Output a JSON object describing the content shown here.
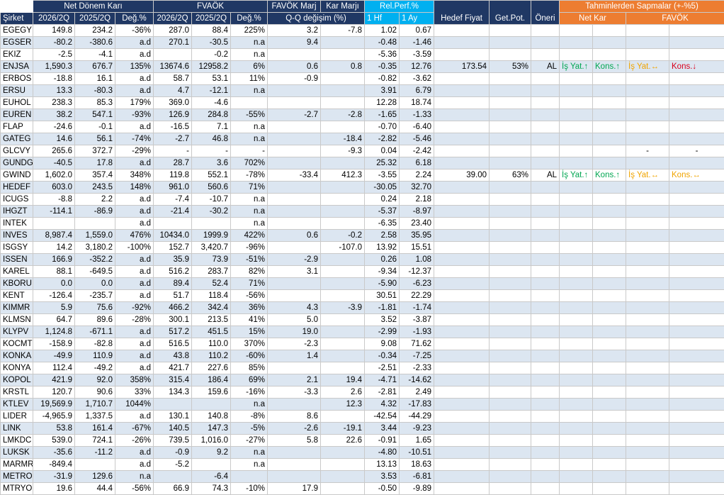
{
  "columns": {
    "company": "Şirket",
    "net_kar_group": "Net Dönem Karı",
    "favok_group": "FVAÖK",
    "favok_marj": "FAVÖK Marj",
    "kar_marj": "Kar Marjı",
    "qq": "Q-Q değişim (%)",
    "relperf": "Rel.Perf.%",
    "hf1": "1 Hf",
    "ay1": "1 Ay",
    "hedef": "Hedef Fiyat",
    "getpot": "Get.Pot.",
    "oneri": "Öneri",
    "sapma_group": "Tahminlerden Sapmalar (+-%5)",
    "sapma_net": "Net Kar",
    "sapma_favok": "FAVÖK",
    "p2026": "2026/2Q",
    "p2025": "2025/2Q",
    "chg": "Değ.%"
  },
  "rows": [
    {
      "n": "EGEGY",
      "nk26": "149.8",
      "nk25": "234.2",
      "nkc": "-36%",
      "f26": "287.0",
      "f25": "88.4",
      "fc": "225%",
      "fm": "3.2",
      "km": "-7.8",
      "hf": "1.02",
      "ay": "0.67",
      "hd": "",
      "gp": "",
      "on": "",
      "s1": "",
      "s2": "",
      "s3": "",
      "s4": ""
    },
    {
      "n": "EGSER",
      "nk26": "-80.2",
      "nk25": "-380.6",
      "nkc": "a.d",
      "f26": "270.1",
      "f25": "-30.5",
      "fc": "n.a",
      "fm": "9.4",
      "km": "",
      "hf": "-0.48",
      "ay": "-1.46",
      "hd": "",
      "gp": "",
      "on": "",
      "s1": "",
      "s2": "",
      "s3": "",
      "s4": ""
    },
    {
      "n": "EKIZ",
      "nk26": "-2.5",
      "nk25": "-4.1",
      "nkc": "a.d",
      "f26": "",
      "f25": "-0.2",
      "fc": "n.a",
      "fm": "",
      "km": "",
      "hf": "-5.36",
      "ay": "-3.59",
      "hd": "",
      "gp": "",
      "on": "",
      "s1": "",
      "s2": "",
      "s3": "",
      "s4": ""
    },
    {
      "n": "ENJSA",
      "nk26": "1,590.3",
      "nk25": "676.7",
      "nkc": "135%",
      "f26": "13674.6",
      "f25": "12958.2",
      "fc": "6%",
      "fm": "0.6",
      "km": "0.8",
      "hf": "-0.35",
      "ay": "12.76",
      "hd": "173.54",
      "gp": "53%",
      "on": "AL",
      "s1": "İş Yat.↑",
      "s2": "Kons.↑",
      "s3": "İş Yat.↔",
      "s4": "Kons.↓",
      "c1": "green",
      "c2": "green",
      "c3": "amber",
      "c4": "red"
    },
    {
      "n": "ERBOS",
      "nk26": "-18.8",
      "nk25": "16.1",
      "nkc": "a.d",
      "f26": "58.7",
      "f25": "53.1",
      "fc": "11%",
      "fm": "-0.9",
      "km": "",
      "hf": "-0.82",
      "ay": "-3.62",
      "hd": "",
      "gp": "",
      "on": "",
      "s1": "",
      "s2": "",
      "s3": "",
      "s4": ""
    },
    {
      "n": "ERSU",
      "nk26": "13.3",
      "nk25": "-80.3",
      "nkc": "a.d",
      "f26": "4.7",
      "f25": "-12.1",
      "fc": "n.a",
      "fm": "",
      "km": "",
      "hf": "3.91",
      "ay": "6.79",
      "hd": "",
      "gp": "",
      "on": "",
      "s1": "",
      "s2": "",
      "s3": "",
      "s4": ""
    },
    {
      "n": "EUHOL",
      "nk26": "238.3",
      "nk25": "85.3",
      "nkc": "179%",
      "f26": "369.0",
      "f25": "-4.6",
      "fc": "",
      "fm": "",
      "km": "",
      "hf": "12.28",
      "ay": "18.74",
      "hd": "",
      "gp": "",
      "on": "",
      "s1": "",
      "s2": "",
      "s3": "",
      "s4": ""
    },
    {
      "n": "EUREN",
      "nk26": "38.2",
      "nk25": "547.1",
      "nkc": "-93%",
      "f26": "126.9",
      "f25": "284.8",
      "fc": "-55%",
      "fm": "-2.7",
      "km": "-2.8",
      "hf": "-1.65",
      "ay": "-1.33",
      "hd": "",
      "gp": "",
      "on": "",
      "s1": "",
      "s2": "",
      "s3": "",
      "s4": ""
    },
    {
      "n": "FLAP",
      "nk26": "-24.6",
      "nk25": "-0.1",
      "nkc": "a.d",
      "f26": "-16.5",
      "f25": "7.1",
      "fc": "n.a",
      "fm": "",
      "km": "",
      "hf": "-0.70",
      "ay": "-6.40",
      "hd": "",
      "gp": "",
      "on": "",
      "s1": "",
      "s2": "",
      "s3": "",
      "s4": ""
    },
    {
      "n": "GATEG",
      "nk26": "14.6",
      "nk25": "56.1",
      "nkc": "-74%",
      "f26": "-2.7",
      "f25": "46.8",
      "fc": "n.a",
      "fm": "",
      "km": "-18.4",
      "hf": "-2.82",
      "ay": "-5.46",
      "hd": "",
      "gp": "",
      "on": "",
      "s1": "",
      "s2": "",
      "s3": "",
      "s4": ""
    },
    {
      "n": "GLCVY",
      "nk26": "265.6",
      "nk25": "372.7",
      "nkc": "-29%",
      "f26": "-",
      "f25": "-",
      "fc": "-",
      "fm": "",
      "km": "-9.3",
      "hf": "0.04",
      "ay": "-2.42",
      "hd": "",
      "gp": "",
      "on": "",
      "s1": "",
      "s2": "",
      "s3": "-",
      "s4": "-",
      "c3": "plain",
      "c4": "plain"
    },
    {
      "n": "GUNDG",
      "nk26": "-40.5",
      "nk25": "17.8",
      "nkc": "a.d",
      "f26": "28.7",
      "f25": "3.6",
      "fc": "702%",
      "fm": "",
      "km": "",
      "hf": "25.32",
      "ay": "6.18",
      "hd": "",
      "gp": "",
      "on": "",
      "s1": "",
      "s2": "",
      "s3": "",
      "s4": ""
    },
    {
      "n": "GWIND",
      "nk26": "1,602.0",
      "nk25": "357.4",
      "nkc": "348%",
      "f26": "119.8",
      "f25": "552.1",
      "fc": "-78%",
      "fm": "-33.4",
      "km": "412.3",
      "hf": "-3.55",
      "ay": "2.24",
      "hd": "39.00",
      "gp": "63%",
      "on": "AL",
      "s1": "İş Yat.↑",
      "s2": "Kons.↑",
      "s3": "İş Yat.↔",
      "s4": "Kons.↔",
      "c1": "green",
      "c2": "green",
      "c3": "amber",
      "c4": "amber"
    },
    {
      "n": "HEDEF",
      "nk26": "603.0",
      "nk25": "243.5",
      "nkc": "148%",
      "f26": "961.0",
      "f25": "560.6",
      "fc": "71%",
      "fm": "",
      "km": "",
      "hf": "-30.05",
      "ay": "32.70",
      "hd": "",
      "gp": "",
      "on": "",
      "s1": "",
      "s2": "",
      "s3": "",
      "s4": ""
    },
    {
      "n": "ICUGS",
      "nk26": "-8.8",
      "nk25": "2.2",
      "nkc": "a.d",
      "f26": "-7.4",
      "f25": "-10.7",
      "fc": "n.a",
      "fm": "",
      "km": "",
      "hf": "0.24",
      "ay": "2.18",
      "hd": "",
      "gp": "",
      "on": "",
      "s1": "",
      "s2": "",
      "s3": "",
      "s4": ""
    },
    {
      "n": "IHGZT",
      "nk26": "-114.1",
      "nk25": "-86.9",
      "nkc": "a.d",
      "f26": "-21.4",
      "f25": "-30.2",
      "fc": "n.a",
      "fm": "",
      "km": "",
      "hf": "-5.37",
      "ay": "-8.97",
      "hd": "",
      "gp": "",
      "on": "",
      "s1": "",
      "s2": "",
      "s3": "",
      "s4": ""
    },
    {
      "n": "INTEK",
      "nk26": "",
      "nk25": "",
      "nkc": "a.d",
      "f26": "",
      "f25": "",
      "fc": "n.a",
      "fm": "",
      "km": "",
      "hf": "-6.35",
      "ay": "23.40",
      "hd": "",
      "gp": "",
      "on": "",
      "s1": "",
      "s2": "",
      "s3": "",
      "s4": ""
    },
    {
      "n": "INVES",
      "nk26": "8,987.4",
      "nk25": "1,559.0",
      "nkc": "476%",
      "f26": "10434.0",
      "f25": "1999.9",
      "fc": "422%",
      "fm": "0.6",
      "km": "-0.2",
      "hf": "2.58",
      "ay": "35.95",
      "hd": "",
      "gp": "",
      "on": "",
      "s1": "",
      "s2": "",
      "s3": "",
      "s4": ""
    },
    {
      "n": "ISGSY",
      "nk26": "14.2",
      "nk25": "3,180.2",
      "nkc": "-100%",
      "f26": "152.7",
      "f25": "3,420.7",
      "fc": "-96%",
      "fm": "",
      "km": "-107.0",
      "hf": "13.92",
      "ay": "15.51",
      "hd": "",
      "gp": "",
      "on": "",
      "s1": "",
      "s2": "",
      "s3": "",
      "s4": ""
    },
    {
      "n": "ISSEN",
      "nk26": "166.9",
      "nk25": "-352.2",
      "nkc": "a.d",
      "f26": "35.9",
      "f25": "73.9",
      "fc": "-51%",
      "fm": "-2.9",
      "km": "",
      "hf": "0.26",
      "ay": "1.08",
      "hd": "",
      "gp": "",
      "on": "",
      "s1": "",
      "s2": "",
      "s3": "",
      "s4": ""
    },
    {
      "n": "KAREL",
      "nk26": "88.1",
      "nk25": "-649.5",
      "nkc": "a.d",
      "f26": "516.2",
      "f25": "283.7",
      "fc": "82%",
      "fm": "3.1",
      "km": "",
      "hf": "-9.34",
      "ay": "-12.37",
      "hd": "",
      "gp": "",
      "on": "",
      "s1": "",
      "s2": "",
      "s3": "",
      "s4": ""
    },
    {
      "n": "KBORU",
      "nk26": "0.0",
      "nk25": "0.0",
      "nkc": "a.d",
      "f26": "89.4",
      "f25": "52.4",
      "fc": "71%",
      "fm": "",
      "km": "",
      "hf": "-5.90",
      "ay": "-6.23",
      "hd": "",
      "gp": "",
      "on": "",
      "s1": "",
      "s2": "",
      "s3": "",
      "s4": ""
    },
    {
      "n": "KENT",
      "nk26": "-126.4",
      "nk25": "-235.7",
      "nkc": "a.d",
      "f26": "51.7",
      "f25": "118.4",
      "fc": "-56%",
      "fm": "",
      "km": "",
      "hf": "30.51",
      "ay": "22.29",
      "hd": "",
      "gp": "",
      "on": "",
      "s1": "",
      "s2": "",
      "s3": "",
      "s4": ""
    },
    {
      "n": "KIMMR",
      "nk26": "5.9",
      "nk25": "75.6",
      "nkc": "-92%",
      "f26": "466.2",
      "f25": "342.4",
      "fc": "36%",
      "fm": "4.3",
      "km": "-3.9",
      "hf": "-1.81",
      "ay": "-1.74",
      "hd": "",
      "gp": "",
      "on": "",
      "s1": "",
      "s2": "",
      "s3": "",
      "s4": ""
    },
    {
      "n": "KLMSN",
      "nk26": "64.7",
      "nk25": "89.6",
      "nkc": "-28%",
      "f26": "300.1",
      "f25": "213.5",
      "fc": "41%",
      "fm": "5.0",
      "km": "",
      "hf": "3.52",
      "ay": "-3.87",
      "hd": "",
      "gp": "",
      "on": "",
      "s1": "",
      "s2": "",
      "s3": "",
      "s4": ""
    },
    {
      "n": "KLYPV",
      "nk26": "1,124.8",
      "nk25": "-671.1",
      "nkc": "a.d",
      "f26": "517.2",
      "f25": "451.5",
      "fc": "15%",
      "fm": "19.0",
      "km": "",
      "hf": "-2.99",
      "ay": "-1.93",
      "hd": "",
      "gp": "",
      "on": "",
      "s1": "",
      "s2": "",
      "s3": "",
      "s4": ""
    },
    {
      "n": "KOCMT",
      "nk26": "-158.9",
      "nk25": "-82.8",
      "nkc": "a.d",
      "f26": "516.5",
      "f25": "110.0",
      "fc": "370%",
      "fm": "-2.3",
      "km": "",
      "hf": "9.08",
      "ay": "71.62",
      "hd": "",
      "gp": "",
      "on": "",
      "s1": "",
      "s2": "",
      "s3": "",
      "s4": ""
    },
    {
      "n": "KONKA",
      "nk26": "-49.9",
      "nk25": "110.9",
      "nkc": "a.d",
      "f26": "43.8",
      "f25": "110.2",
      "fc": "-60%",
      "fm": "1.4",
      "km": "",
      "hf": "-0.34",
      "ay": "-7.25",
      "hd": "",
      "gp": "",
      "on": "",
      "s1": "",
      "s2": "",
      "s3": "",
      "s4": ""
    },
    {
      "n": "KONYA",
      "nk26": "112.4",
      "nk25": "-49.2",
      "nkc": "a.d",
      "f26": "421.7",
      "f25": "227.6",
      "fc": "85%",
      "fm": "",
      "km": "",
      "hf": "-2.51",
      "ay": "-2.33",
      "hd": "",
      "gp": "",
      "on": "",
      "s1": "",
      "s2": "",
      "s3": "",
      "s4": ""
    },
    {
      "n": "KOPOL",
      "nk26": "421.9",
      "nk25": "92.0",
      "nkc": "358%",
      "f26": "315.4",
      "f25": "186.4",
      "fc": "69%",
      "fm": "2.1",
      "km": "19.4",
      "hf": "-4.71",
      "ay": "-14.62",
      "hd": "",
      "gp": "",
      "on": "",
      "s1": "",
      "s2": "",
      "s3": "",
      "s4": ""
    },
    {
      "n": "KRSTL",
      "nk26": "120.7",
      "nk25": "90.6",
      "nkc": "33%",
      "f26": "134.3",
      "f25": "159.6",
      "fc": "-16%",
      "fm": "-3.3",
      "km": "2.6",
      "hf": "-2.81",
      "ay": "2.49",
      "hd": "",
      "gp": "",
      "on": "",
      "s1": "",
      "s2": "",
      "s3": "",
      "s4": ""
    },
    {
      "n": "KTLEV",
      "nk26": "19,569.9",
      "nk25": "1,710.7",
      "nkc": "1044%",
      "f26": "",
      "f25": "",
      "fc": "n.a",
      "fm": "",
      "km": "12.3",
      "hf": "4.32",
      "ay": "-17.83",
      "hd": "",
      "gp": "",
      "on": "",
      "s1": "",
      "s2": "",
      "s3": "",
      "s4": ""
    },
    {
      "n": "LIDER",
      "nk26": "-4,965.9",
      "nk25": "1,337.5",
      "nkc": "a.d",
      "f26": "130.1",
      "f25": "140.8",
      "fc": "-8%",
      "fm": "8.6",
      "km": "",
      "hf": "-42.54",
      "ay": "-44.29",
      "hd": "",
      "gp": "",
      "on": "",
      "s1": "",
      "s2": "",
      "s3": "",
      "s4": ""
    },
    {
      "n": "LINK",
      "nk26": "53.8",
      "nk25": "161.4",
      "nkc": "-67%",
      "f26": "140.5",
      "f25": "147.3",
      "fc": "-5%",
      "fm": "-2.6",
      "km": "-19.1",
      "hf": "3.44",
      "ay": "-9.23",
      "hd": "",
      "gp": "",
      "on": "",
      "s1": "",
      "s2": "",
      "s3": "",
      "s4": ""
    },
    {
      "n": "LMKDC",
      "nk26": "539.0",
      "nk25": "724.1",
      "nkc": "-26%",
      "f26": "739.5",
      "f25": "1,016.0",
      "fc": "-27%",
      "fm": "5.8",
      "km": "22.6",
      "hf": "-0.91",
      "ay": "1.65",
      "hd": "",
      "gp": "",
      "on": "",
      "s1": "",
      "s2": "",
      "s3": "",
      "s4": ""
    },
    {
      "n": "LUKSK",
      "nk26": "-35.6",
      "nk25": "-11.2",
      "nkc": "a.d",
      "f26": "-0.9",
      "f25": "9.2",
      "fc": "n.a",
      "fm": "",
      "km": "",
      "hf": "-4.80",
      "ay": "-10.51",
      "hd": "",
      "gp": "",
      "on": "",
      "s1": "",
      "s2": "",
      "s3": "",
      "s4": ""
    },
    {
      "n": "MARMR",
      "nk26": "-849.4",
      "nk25": "",
      "nkc": "a.d",
      "f26": "-5.2",
      "f25": "",
      "fc": "n.a",
      "fm": "",
      "km": "",
      "hf": "13.13",
      "ay": "18.63",
      "hd": "",
      "gp": "",
      "on": "",
      "s1": "",
      "s2": "",
      "s3": "",
      "s4": ""
    },
    {
      "n": "METRO",
      "nk26": "-31.9",
      "nk25": "129.6",
      "nkc": "n.a",
      "f26": "",
      "f25": "-6.4",
      "fc": "",
      "fm": "",
      "km": "",
      "hf": "3.53",
      "ay": "-6.81",
      "hd": "",
      "gp": "",
      "on": "",
      "s1": "",
      "s2": "",
      "s3": "",
      "s4": ""
    },
    {
      "n": "MTRYO",
      "nk26": "19.6",
      "nk25": "44.4",
      "nkc": "-56%",
      "f26": "66.9",
      "f25": "74.3",
      "fc": "-10%",
      "fm": "17.9",
      "km": "",
      "hf": "-0.50",
      "ay": "-9.89",
      "hd": "",
      "gp": "",
      "on": "",
      "s1": "",
      "s2": "",
      "s3": "",
      "s4": ""
    }
  ]
}
